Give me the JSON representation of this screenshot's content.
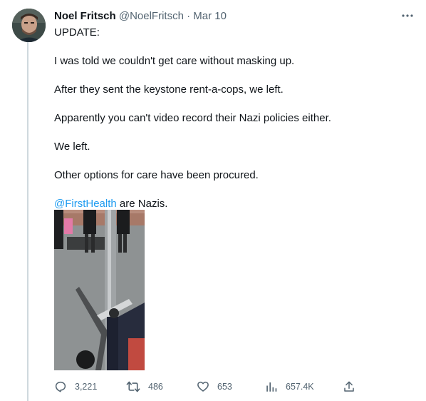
{
  "tweet": {
    "author_name": "Noel Fritsch",
    "author_handle": "@NoelFritsch",
    "separator": "·",
    "date": "Mar 10",
    "lines": [
      "UPDATE:",
      "I was told we couldn't get care without masking up.",
      "After they sent the keystone rent-a-cops, we left.",
      "Apparently you can't video record their Nazi policies either.",
      "We left.",
      "Other options for care have been procured."
    ],
    "final_mention": "@FirstHealth",
    "final_text": " are Nazis."
  },
  "actions": {
    "reply": {
      "icon": "reply-icon",
      "count": "3,221"
    },
    "retweet": {
      "icon": "retweet-icon",
      "count": "486"
    },
    "like": {
      "icon": "heart-icon",
      "count": "653"
    },
    "views": {
      "icon": "views-chart-icon",
      "count": "657.4K"
    },
    "share": {
      "icon": "share-icon"
    }
  },
  "colors": {
    "text": "#0f1419",
    "secondary": "#536471",
    "link": "#1d9bf0",
    "thread_line": "#cfd9de"
  }
}
